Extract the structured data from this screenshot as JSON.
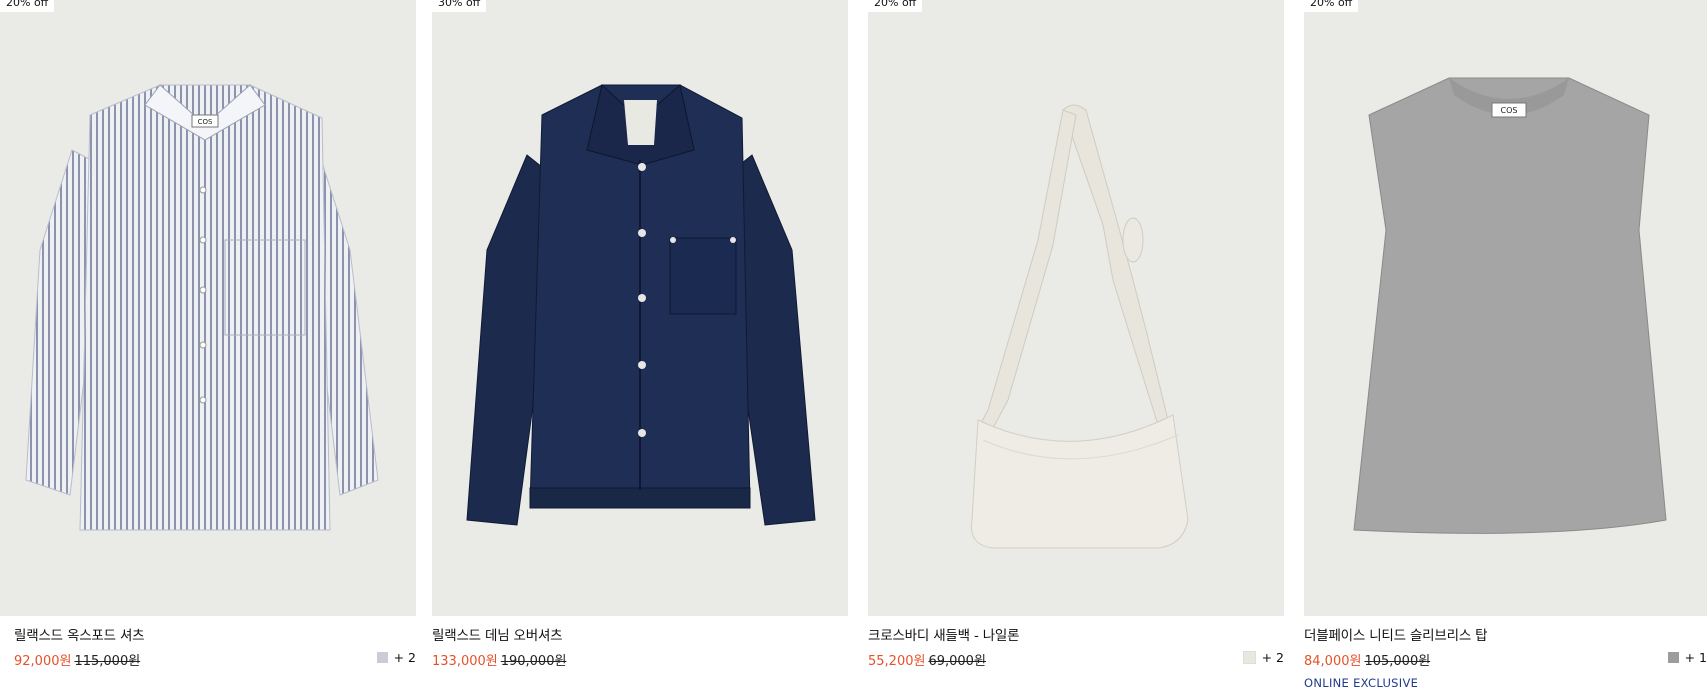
{
  "products": [
    {
      "badge": "20% off",
      "name": "릴랙스드 옥스포드 셔츠",
      "sale_price": "92,000원",
      "original_price": "115,000원",
      "swatch_color": "#c9ccd6",
      "more_colors": "+ 2"
    },
    {
      "badge": "30% off",
      "name": "릴랙스드 데님 오버셔츠",
      "sale_price": "133,000원",
      "original_price": "190,000원"
    },
    {
      "badge": "20% off",
      "name": "크로스바디 새들백 - 나일론",
      "sale_price": "55,200원",
      "original_price": "69,000원",
      "swatch_color": "#e9e7df",
      "more_colors": "+ 2"
    },
    {
      "badge": "20% off",
      "name": "더블페이스 니티드 슬리브리스 탑",
      "sale_price": "84,000원",
      "original_price": "105,000원",
      "swatch_color": "#9c9c9c",
      "more_colors": "+ 1",
      "tag": "ONLINE EXCLUSIVE"
    }
  ],
  "garment_label": "COS"
}
